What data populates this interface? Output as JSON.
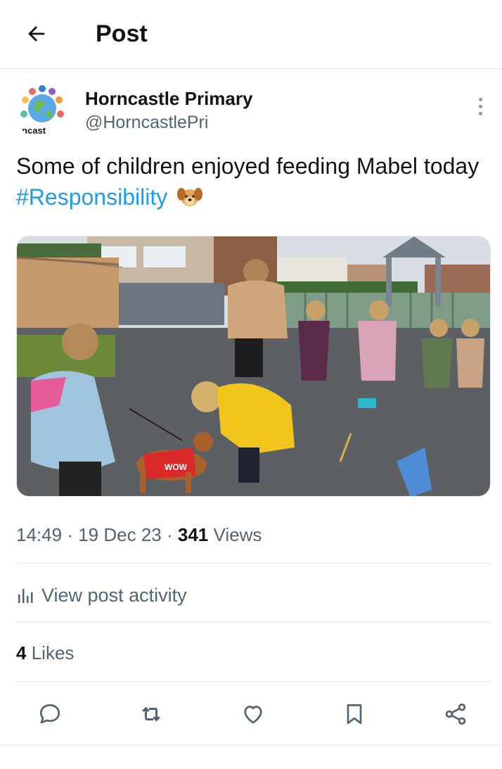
{
  "header": {
    "title": "Post",
    "back_icon": "arrow-left-icon"
  },
  "author": {
    "name": "Horncastle Primary",
    "handle": "@HorncastlePri",
    "avatar_text": "rncast",
    "more_icon": "more-vertical-icon"
  },
  "post": {
    "text": "Some of children enjoyed feeding Mabel today",
    "hashtag": "#Responsibility",
    "emoji": "dog-face-emoji"
  },
  "media": {
    "dog_coat_text": "WOW"
  },
  "meta": {
    "time": "14:49",
    "separator": "·",
    "date": "19 Dec 23",
    "views_count": "341",
    "views_label": "Views"
  },
  "activity": {
    "label": "View post activity",
    "icon": "bar-chart-icon"
  },
  "likes": {
    "count": "4",
    "label": "Likes"
  },
  "actions": [
    {
      "name": "reply",
      "icon": "reply-bubble-icon"
    },
    {
      "name": "repost",
      "icon": "repost-icon"
    },
    {
      "name": "like",
      "icon": "heart-icon"
    },
    {
      "name": "bookmark",
      "icon": "bookmark-icon"
    },
    {
      "name": "share",
      "icon": "share-icon"
    }
  ],
  "colors": {
    "text": "#0f1419",
    "secondary": "#536471",
    "link": "#1d9bf0",
    "border": "#e6e9ec"
  }
}
